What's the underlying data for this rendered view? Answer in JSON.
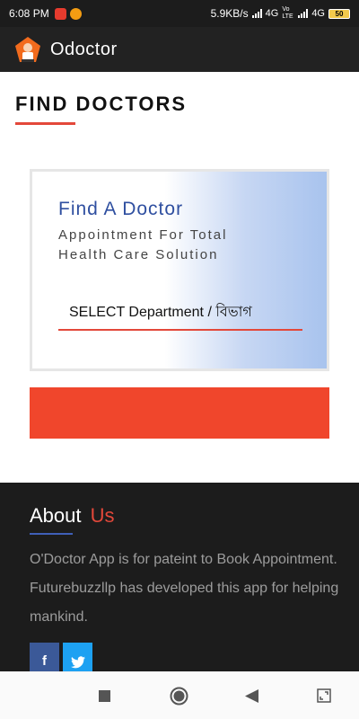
{
  "status_bar": {
    "time": "6:08 PM",
    "net_speed": "5.9KB/s",
    "network1": "4G",
    "volte": "Vo LTE",
    "network2": "4G",
    "battery": "50"
  },
  "app_bar": {
    "title": "Odoctor",
    "logo_icon": "doctor-logo-icon"
  },
  "page": {
    "title": "FIND DOCTORS"
  },
  "card": {
    "title": "Find A Doctor",
    "subtitle_line1": "Appointment For Total",
    "subtitle_line2": "Health Care Solution",
    "select_label": "SELECT Department / বিভাগ"
  },
  "about": {
    "heading_main": "About",
    "heading_accent": "Us",
    "text": "O'Doctor App is for pateint to Book Appointment. Futurebuzzllp has developed this app for helping mankind.",
    "facebook_label": "f",
    "twitter_label": "t"
  },
  "colors": {
    "accent": "#e3483a",
    "button": "#f0462c",
    "heading_blue": "#2f4fa0",
    "dark_bg": "#1c1c1c"
  },
  "icons": [
    "recents-square-icon",
    "home-circle-icon",
    "back-triangle-icon",
    "screenshot-icon"
  ]
}
